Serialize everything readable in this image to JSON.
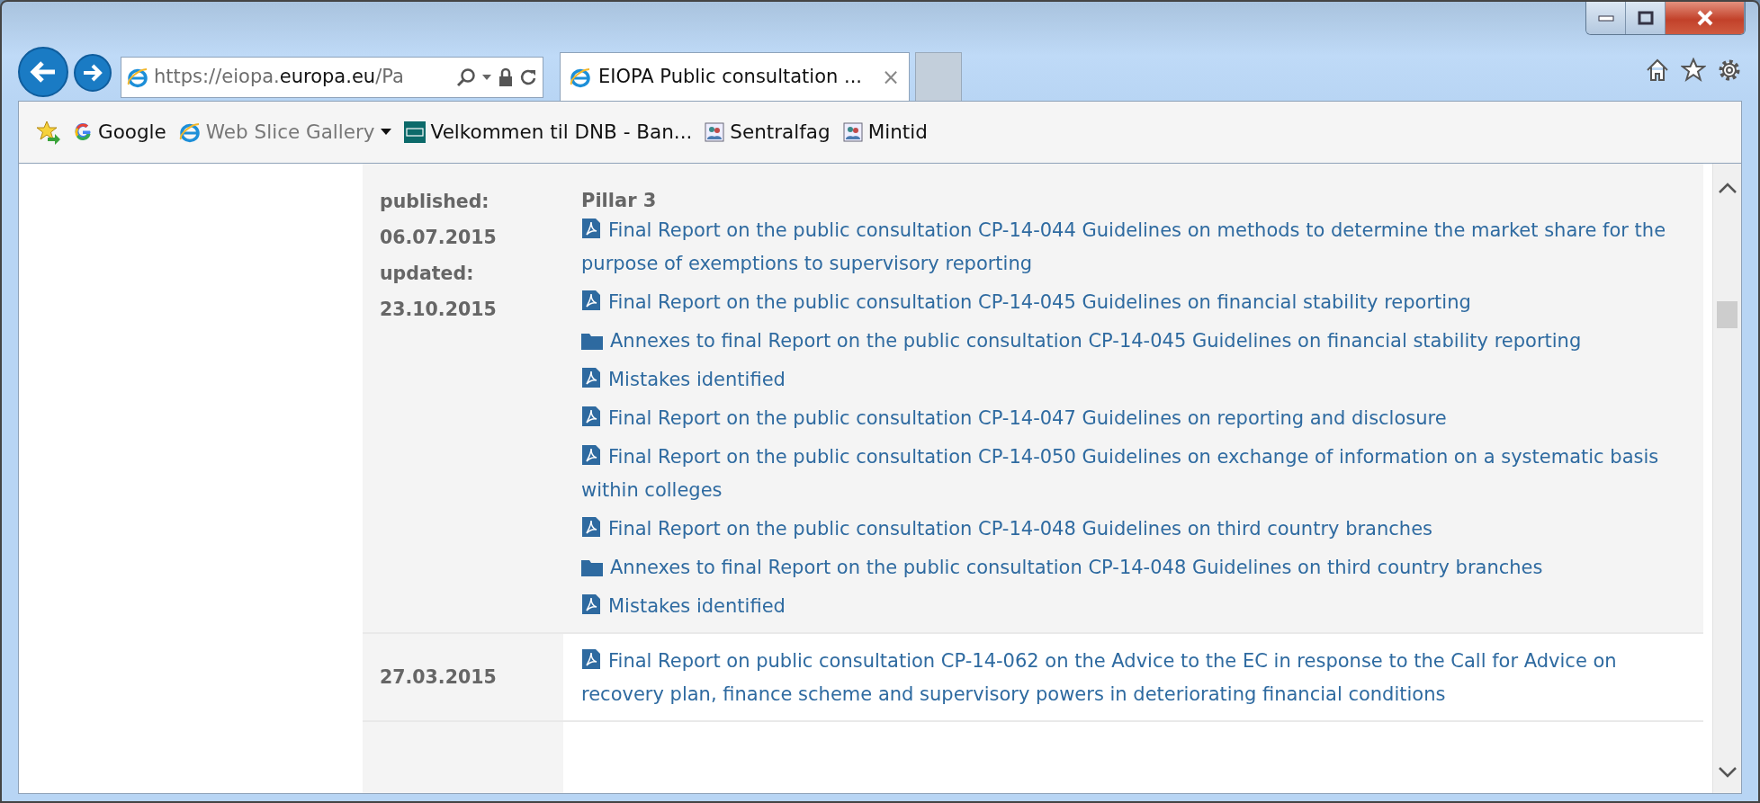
{
  "address_bar": {
    "url": [
      {
        "text": "https://eiopa.",
        "strong": false
      },
      {
        "text": "europa.eu",
        "strong": true
      },
      {
        "text": "/Pa",
        "strong": false
      }
    ]
  },
  "tabs": [
    {
      "title": "EIOPA Public consultation ...",
      "selected": true,
      "close": "×"
    }
  ],
  "favorites": [
    {
      "kind": "google",
      "label": "Google",
      "dimmed": false,
      "menu": false
    },
    {
      "kind": "ie",
      "label": "Web Slice Gallery",
      "dimmed": true,
      "menu": true
    },
    {
      "kind": "dnb",
      "label": "Velkommen til DNB - Ban...",
      "dimmed": false,
      "menu": false
    },
    {
      "kind": "portal",
      "label": "Sentralfag",
      "dimmed": false,
      "menu": false
    },
    {
      "kind": "portal",
      "label": "Mintid",
      "dimmed": false,
      "menu": false
    }
  ],
  "rows": [
    {
      "kind": "group",
      "dates": [
        "published:",
        "06.07.2015",
        "updated:",
        "23.10.2015"
      ],
      "heading": "Pillar 3",
      "items": [
        {
          "kind": "pdf",
          "text": "Final Report on the public consultation CP-14-044 Guidelines on methods to determine the market share for the purpose of exemptions to supervisory reporting"
        },
        {
          "kind": "pdf",
          "text": "Final Report on the public consultation CP-14-045 Guidelines on financial stability reporting"
        },
        {
          "kind": "folder",
          "text": "Annexes to final Report on the public consultation CP-14-045 Guidelines on financial stability reporting"
        },
        {
          "kind": "pdf",
          "text": "Mistakes identified"
        },
        {
          "kind": "pdf",
          "text": "Final Report on the public consultation CP-14-047 Guidelines on reporting and disclosure"
        },
        {
          "kind": "pdf",
          "text": "Final Report on the public consultation CP-14-050 Guidelines on exchange of information on a systematic basis within colleges"
        },
        {
          "kind": "pdf",
          "text": "Final Report on the public consultation CP-14-048 Guidelines on third country branches"
        },
        {
          "kind": "folder",
          "text": "Annexes to final Report on the public consultation CP-14-048 Guidelines on third country branches"
        },
        {
          "kind": "pdf",
          "text": "Mistakes identified"
        }
      ]
    },
    {
      "kind": "single",
      "dates": [
        "27.03.2015"
      ],
      "items": [
        {
          "kind": "pdf",
          "text": "Final Report on public consultation CP-14-062 on the Advice to the EC in response to the Call for Advice on recovery plan, finance scheme and supervisory powers in deteriorating financial conditions"
        }
      ]
    }
  ]
}
